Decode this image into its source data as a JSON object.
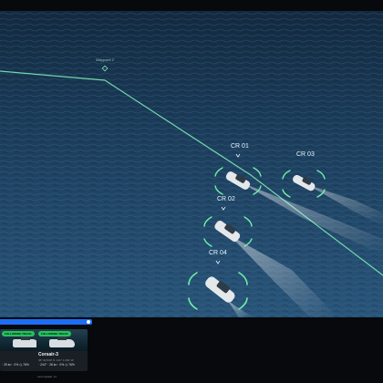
{
  "map": {
    "waypoint_label": "Waypoint 2",
    "colors": {
      "route": "#7ce8b5",
      "ring": "#6ff0a8",
      "wake": "#ffffff",
      "water": "#24496a"
    }
  },
  "vessels": [
    {
      "label": "CR 01"
    },
    {
      "label": "CR 03"
    },
    {
      "label": "CR 02"
    },
    {
      "label": "CR 04"
    }
  ],
  "bottom_panel": {
    "cards": [
      {
        "badge": "FOLLOWING TRACK",
        "name": "",
        "meta": "",
        "stats": "· 25 kn · 0% ◷ 76%"
      },
      {
        "badge": "FOLLOWING TRACK",
        "name": "Corsair-3",
        "meta": "36° 02.530' N, 141° 1.032' W",
        "stats": "· 244° · 28 kn · 0% ◷ 76%"
      }
    ],
    "last_update": "Last Update: 1s"
  }
}
